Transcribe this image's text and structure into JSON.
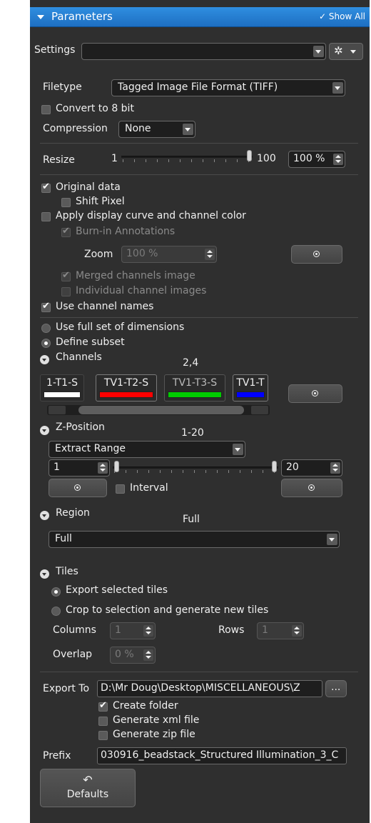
{
  "header": {
    "title": "Parameters",
    "show_all": "✓ Show All"
  },
  "settings": {
    "label": "Settings",
    "value": ""
  },
  "filetype": {
    "label": "Filetype",
    "value": "Tagged Image File Format (TIFF)"
  },
  "convert_8bit": {
    "label": "Convert to 8 bit",
    "checked": false
  },
  "compression": {
    "label": "Compression",
    "value": "None"
  },
  "resize": {
    "label": "Resize",
    "min": "1",
    "max": "100",
    "value": "100 %",
    "slider_fraction": 1.0
  },
  "original_data": {
    "label": "Original data",
    "checked": true
  },
  "shift_pixel": {
    "label": "Shift Pixel",
    "checked": false
  },
  "apply_display_curve": {
    "label": "Apply display curve and channel color",
    "checked": false
  },
  "burn_in": {
    "label": "Burn-in Annotations",
    "checked": true,
    "enabled": false
  },
  "zoom": {
    "label": "Zoom",
    "value": "100 %"
  },
  "merged_channels": {
    "label": "Merged channels image",
    "checked": true,
    "enabled": false
  },
  "individual_channels": {
    "label": "Individual channel images",
    "checked": false,
    "enabled": false
  },
  "use_channel_names": {
    "label": "Use channel names",
    "checked": true
  },
  "use_full_set": {
    "label": "Use full set of dimensions",
    "selected": false
  },
  "define_subset": {
    "label": "Define subset",
    "selected": true
  },
  "channels": {
    "label": "Channels",
    "summary": "2,4",
    "items": [
      {
        "label": "1-T1-S",
        "color": "#ffffff"
      },
      {
        "label": "TV1-T2-S",
        "color": "#ff0000"
      },
      {
        "label": "TV1-T3-S",
        "color": "#00cc00"
      },
      {
        "label": "TV1-T",
        "color": "#0000ff"
      }
    ]
  },
  "z_position": {
    "label": "Z-Position",
    "summary": "1-20",
    "mode": "Extract Range",
    "start": "1",
    "end": "20",
    "interval_label": "Interval",
    "interval_checked": false
  },
  "region": {
    "label": "Region",
    "summary": "Full",
    "value": "Full"
  },
  "tiles": {
    "label": "Tiles",
    "export_selected": {
      "label": "Export selected tiles",
      "selected": true
    },
    "crop_to_selection": {
      "label": "Crop to selection and generate new tiles",
      "selected": false
    },
    "columns_label": "Columns",
    "columns_value": "1",
    "rows_label": "Rows",
    "rows_value": "1",
    "overlap_label": "Overlap",
    "overlap_value": "0 %"
  },
  "export_to": {
    "label": "Export To",
    "path": "D:\\Mr Doug\\Desktop\\MISCELLANEOUS\\Z",
    "browse": "..."
  },
  "create_folder": {
    "label": "Create folder",
    "checked": true
  },
  "generate_xml": {
    "label": "Generate xml file",
    "checked": false
  },
  "generate_zip": {
    "label": "Generate zip file",
    "checked": false
  },
  "prefix": {
    "label": "Prefix",
    "value": "030916_beadstack_Structured Illumination_3_C"
  },
  "defaults_button": {
    "label": "Defaults",
    "icon": "undo-icon"
  },
  "colors": {
    "header": "#1e6fc2",
    "panel": "#2f2f2f"
  }
}
